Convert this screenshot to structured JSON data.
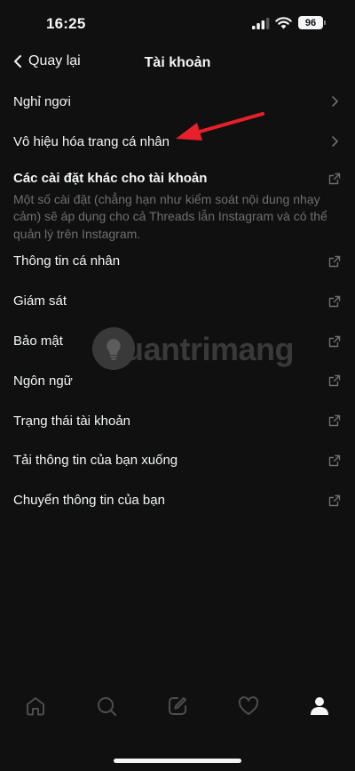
{
  "status_bar": {
    "time": "16:25",
    "battery": "96"
  },
  "nav": {
    "back_label": "Quay lại",
    "title": "Tài khoản"
  },
  "rows_top": [
    {
      "label": "Nghỉ ngơi",
      "icon": "chevron-right-icon"
    },
    {
      "label": "Vô hiệu hóa trang cá nhân",
      "icon": "chevron-right-icon"
    }
  ],
  "section": {
    "title": "Các cài đặt khác cho tài khoản",
    "description": "Một số cài đặt (chẳng hạn như kiểm soát nội dung nhạy cảm) sẽ áp dụng cho cả Threads lẫn Instagram và có thể quản lý trên Instagram.",
    "icon": "external-link-icon"
  },
  "rows_bottom": [
    {
      "label": "Thông tin cá nhân",
      "icon": "external-link-icon"
    },
    {
      "label": "Giám sát",
      "icon": "external-link-icon"
    },
    {
      "label": "Bảo mật",
      "icon": "external-link-icon"
    },
    {
      "label": "Ngôn ngữ",
      "icon": "external-link-icon"
    },
    {
      "label": "Trạng thái tài khoản",
      "icon": "external-link-icon"
    },
    {
      "label": "Tải thông tin của bạn xuống",
      "icon": "external-link-icon"
    },
    {
      "label": "Chuyển thông tin của bạn",
      "icon": "external-link-icon"
    }
  ],
  "watermark": {
    "text": "uantrimang"
  },
  "tabbar": [
    "home-icon",
    "search-icon",
    "compose-icon",
    "heart-icon",
    "profile-icon"
  ],
  "colors": {
    "background": "#101010",
    "text": "#f3f5f7",
    "muted": "#6f6f6f",
    "annotation_arrow": "#e8202a"
  }
}
